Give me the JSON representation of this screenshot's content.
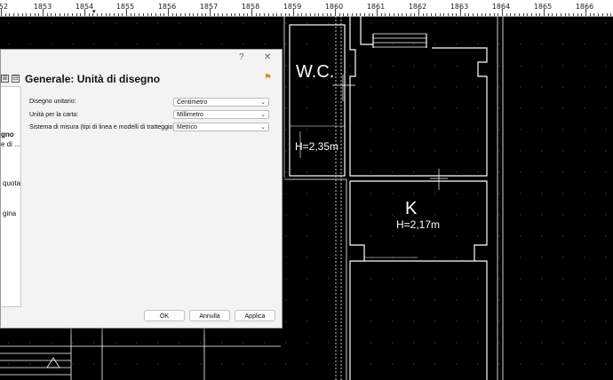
{
  "ruler": {
    "labels": [
      "52",
      "1853",
      "1854",
      "1855",
      "1856",
      "1857",
      "1858",
      "1859",
      "1860",
      "1861",
      "1862",
      "1863",
      "1864",
      "1865",
      "1866"
    ],
    "marker": "▾"
  },
  "drawing": {
    "wc_label": "W.C.",
    "wc_height": "H=2,35m",
    "k_label": "K",
    "k_height": "H=2,17m"
  },
  "dialog": {
    "help_label": "?",
    "close_label": "✕",
    "heading": "Generale: Unità di disegno",
    "expand_label": "⊞",
    "collapse_label": "⊟",
    "tree": [
      "gno",
      "e di ...",
      "quota",
      "gina"
    ],
    "fields": [
      {
        "label": "Disegno unitario:",
        "value": "Centimetro"
      },
      {
        "label": "Unità per la carta:",
        "value": "Millimetro"
      },
      {
        "label": "Sistema di misura (tipi di linea e modelli di tratteggio):",
        "value": "Metrico"
      }
    ],
    "buttons": {
      "ok": "OK",
      "cancel": "Annulla",
      "apply": "Applica"
    }
  }
}
